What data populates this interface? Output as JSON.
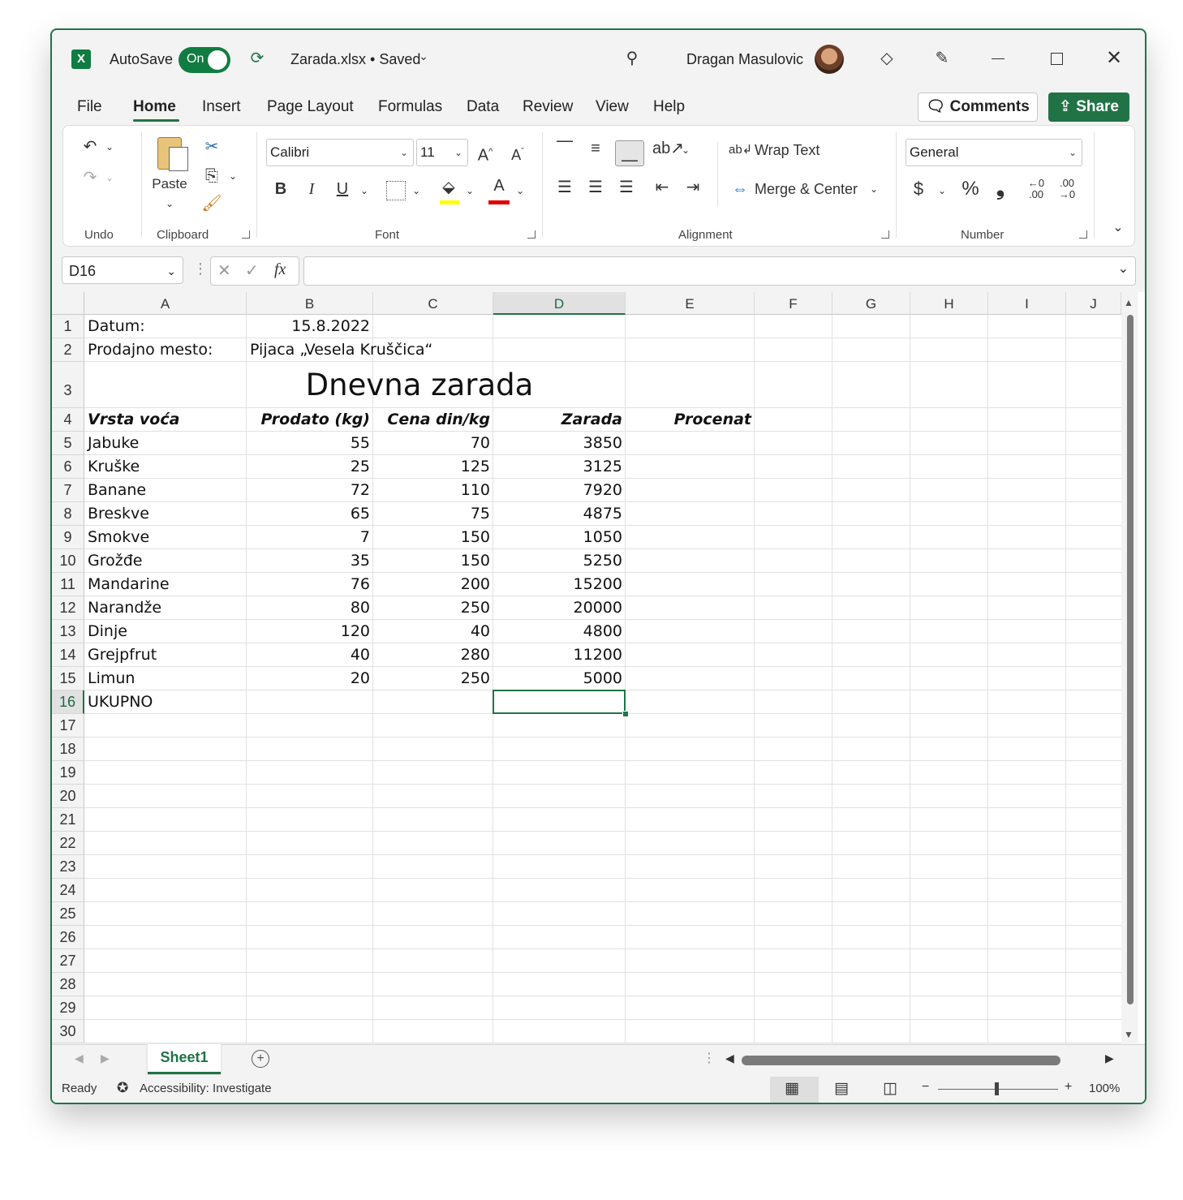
{
  "titlebar": {
    "autosave_label": "AutoSave",
    "autosave_state": "On",
    "filename": "Zarada.xlsx • Saved",
    "user_name": "Dragan Masulovic"
  },
  "menu": {
    "tabs": [
      "File",
      "Home",
      "Insert",
      "Page Layout",
      "Formulas",
      "Data",
      "Review",
      "View",
      "Help"
    ],
    "active": "Home",
    "comments_label": "Comments",
    "share_label": "Share"
  },
  "ribbon": {
    "groups": {
      "undo": "Undo",
      "clipboard": "Clipboard",
      "font": "Font",
      "alignment": "Alignment",
      "number": "Number"
    },
    "paste_label": "Paste",
    "font_name": "Calibri",
    "font_size": "11",
    "wrap_text": "Wrap Text",
    "merge_center": "Merge & Center",
    "number_format": "General",
    "bold": "B",
    "italic": "I",
    "underline": "U",
    "currency": "$",
    "percent": "%",
    "comma": "❟",
    "fx": "fx"
  },
  "formula_bar": {
    "name_box": "D16",
    "formula": ""
  },
  "columns": [
    "A",
    "B",
    "C",
    "D",
    "E",
    "F",
    "G",
    "H",
    "I",
    "J"
  ],
  "selected_col": "D",
  "rows": [
    "1",
    "2",
    "3",
    "4",
    "5",
    "6",
    "7",
    "8",
    "9",
    "10",
    "11",
    "12",
    "13",
    "14",
    "15",
    "16",
    "17",
    "18",
    "19",
    "20",
    "21",
    "22",
    "23",
    "24",
    "25",
    "26",
    "27",
    "28",
    "29",
    "30"
  ],
  "selected_row": "16",
  "sheet": {
    "datum_label": "Datum:",
    "datum_value": "15.8.2022",
    "mesto_label": "Prodajno mesto:",
    "mesto_value": "Pijaca „Vesela Kruščica“",
    "title": "Dnevna zarada",
    "headers": [
      "Vrsta voća",
      "Prodato (kg)",
      "Cena din/kg",
      "Zarada",
      "Procenat"
    ],
    "data": [
      [
        "Jabuke",
        "55",
        "70",
        "3850"
      ],
      [
        "Kruške",
        "25",
        "125",
        "3125"
      ],
      [
        "Banane",
        "72",
        "110",
        "7920"
      ],
      [
        "Breskve",
        "65",
        "75",
        "4875"
      ],
      [
        "Smokve",
        "7",
        "150",
        "1050"
      ],
      [
        "Grožđe",
        "35",
        "150",
        "5250"
      ],
      [
        "Mandarine",
        "76",
        "200",
        "15200"
      ],
      [
        "Narandže",
        "80",
        "250",
        "20000"
      ],
      [
        "Dinje",
        "120",
        "40",
        "4800"
      ],
      [
        "Grejpfrut",
        "40",
        "280",
        "11200"
      ],
      [
        "Limun",
        "20",
        "250",
        "5000"
      ]
    ],
    "total_label": "UKUPNO"
  },
  "sheet_tabs": {
    "active": "Sheet1"
  },
  "status": {
    "ready": "Ready",
    "accessibility": "Accessibility: Investigate",
    "zoom": "100%",
    "zoom_minus": "−",
    "zoom_plus": "+"
  },
  "colors": {
    "accent": "#217346",
    "excel_green": "#107c41"
  }
}
